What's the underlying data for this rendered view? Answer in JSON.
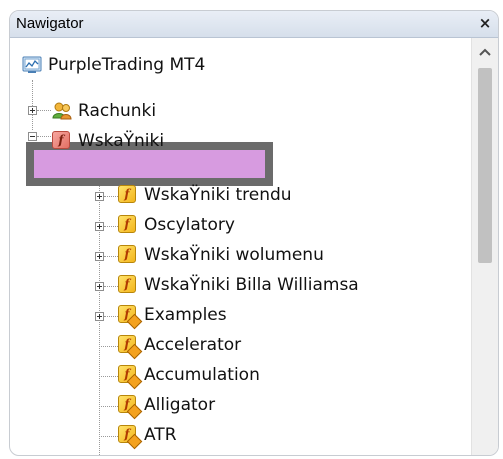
{
  "window": {
    "title": "Nawigator",
    "close_label": "×"
  },
  "tree": {
    "root": "PurpleTrading MT4",
    "accounts": "Rachunki",
    "indicators": "WskaŸniki",
    "children": [
      "WskaŸniki trendu",
      "Oscylatory",
      "WskaŸniki wolumenu",
      "WskaŸniki Billa Williamsa",
      "Examples",
      "Accelerator",
      "Accumulation",
      "Alligator",
      "ATR"
    ]
  },
  "colors": {
    "selection_fill": "#d79be0",
    "selection_border": "#6b6b6b",
    "title_bar": "#dbe3ee"
  }
}
